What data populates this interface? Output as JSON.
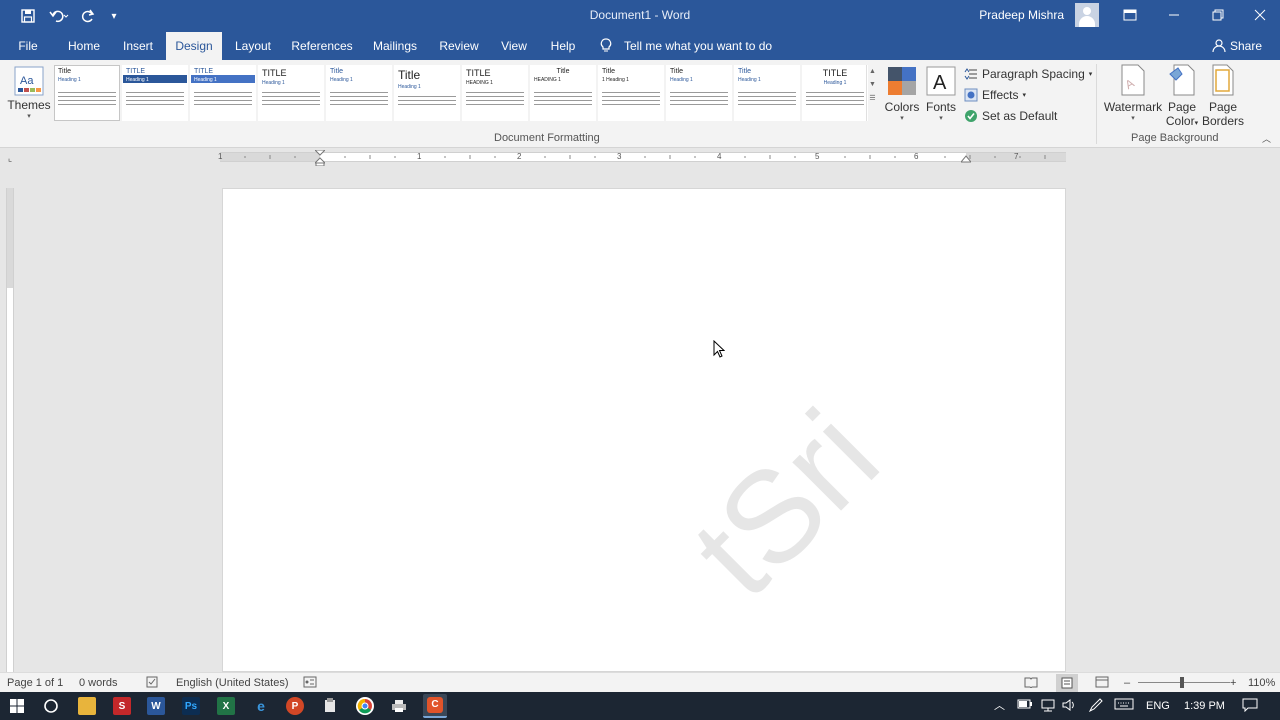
{
  "window": {
    "title": "Document1 - Word",
    "user": "Pradeep Mishra"
  },
  "tabs": [
    "File",
    "Home",
    "Insert",
    "Design",
    "Layout",
    "References",
    "Mailings",
    "Review",
    "View",
    "Help"
  ],
  "active_tab": "Design",
  "tell_me": "Tell me what you want to do",
  "share": "Share",
  "ribbon": {
    "themes_label": "Themes",
    "style_gallery": [
      {
        "title": "Title",
        "heading": "Heading 1"
      },
      {
        "title": "TITLE",
        "heading": "Heading 1"
      },
      {
        "title": "TITLE",
        "heading": "Heading 1"
      },
      {
        "title": "TITLE",
        "heading": "Heading 1"
      },
      {
        "title": "Title",
        "heading": "Heading 1"
      },
      {
        "title": "Title",
        "heading": "Heading 1"
      },
      {
        "title": "TITLE",
        "heading": "HEADING 1"
      },
      {
        "title": "Title",
        "heading": "HEADING 1"
      },
      {
        "title": "Title",
        "heading": "1 Heading 1"
      },
      {
        "title": "Title",
        "heading": "Heading 1"
      },
      {
        "title": "Title",
        "heading": "Heading 1"
      },
      {
        "title": "TITLE",
        "heading": "Heading 1"
      }
    ],
    "colors_label": "Colors",
    "fonts_label": "Fonts",
    "paragraph_spacing": "Paragraph Spacing",
    "effects": "Effects",
    "set_as_default": "Set as Default",
    "document_formatting": "Document Formatting",
    "watermark": "Watermark",
    "page_color_1": "Page",
    "page_color_2": "Color",
    "page_borders_1": "Page",
    "page_borders_2": "Borders",
    "page_background": "Page Background"
  },
  "ruler": {
    "numbers": [
      "1",
      "1",
      "2",
      "3",
      "4",
      "5",
      "6",
      "7"
    ]
  },
  "document": {
    "watermark_text": "tSri"
  },
  "status": {
    "page": "Page 1 of 1",
    "words": "0 words",
    "language": "English (United States)",
    "zoom": "110%"
  },
  "taskbar": {
    "lang": "ENG",
    "time": "1:39 PM"
  },
  "colors": {
    "word_blue": "#2b579a",
    "ribbon_bg": "#f3f3f3",
    "taskbar_bg": "#1c2633"
  }
}
